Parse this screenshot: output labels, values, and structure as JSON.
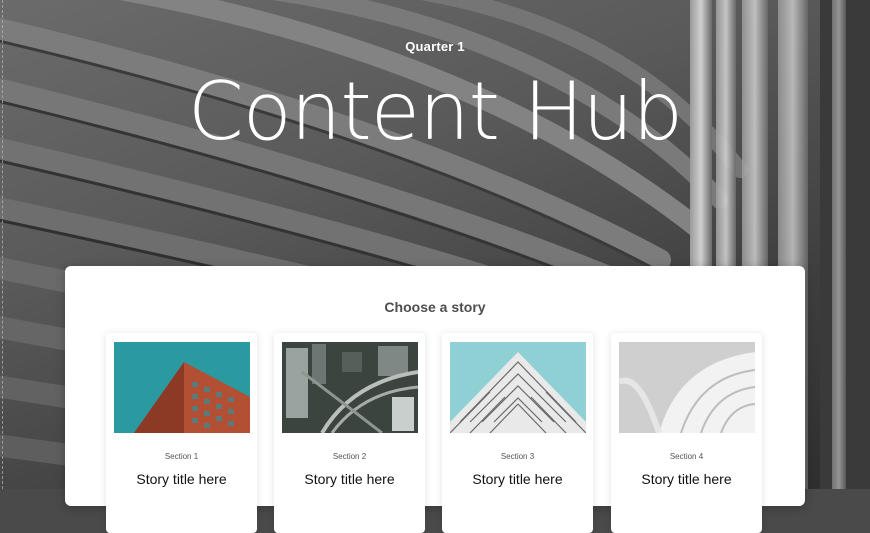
{
  "hero": {
    "eyebrow": "Quarter 1",
    "title": "Content Hub"
  },
  "panel": {
    "heading": "Choose a story",
    "cards": [
      {
        "section": "Section 1",
        "title": "Story title here",
        "image": "red-brick-building-photo"
      },
      {
        "section": "Section 2",
        "title": "Story title here",
        "image": "aerial-city-highway-photo"
      },
      {
        "section": "Section 3",
        "title": "Story title here",
        "image": "white-lattice-tower-photo"
      },
      {
        "section": "Section 4",
        "title": "Story title here",
        "image": "white-curved-architecture-photo"
      }
    ]
  },
  "colors": {
    "panel_bg": "#ffffff",
    "heading_text": "#4e4e4e",
    "hero_text": "#ffffff"
  }
}
